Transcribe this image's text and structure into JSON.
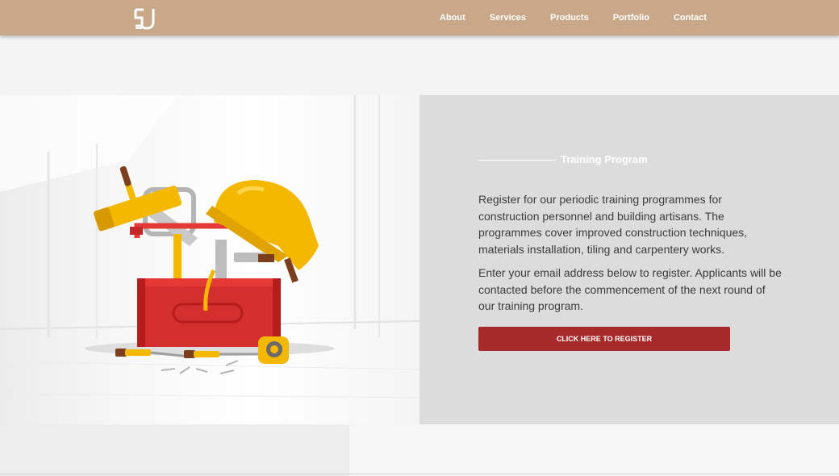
{
  "nav": {
    "logo_icon": "sj-monogram-logo",
    "links": [
      {
        "label": "About"
      },
      {
        "label": "Services"
      },
      {
        "label": "Products"
      },
      {
        "label": "Portfolio"
      },
      {
        "label": "Contact"
      }
    ]
  },
  "training": {
    "heading": "Training Program",
    "paragraph1": "Register for our periodic training programmes for construction personnel and building artisans. The programmes cover improved construction techniques, materials installation, tiling and carpentery works.",
    "paragraph2": "Enter your email address below to register. Applicants will be contacted before the commencement of the next round of our training program.",
    "register_button": "CLICK HERE TO REGISTER"
  },
  "illustration": {
    "icon": "toolbox-with-hardhat-and-tools"
  },
  "colors": {
    "navbar": "#c8a888",
    "accent_button": "#a62a2a",
    "panel_gray": "#dcdcdc",
    "toolbox_red": "#d63031",
    "hardhat_yellow": "#f7b500"
  }
}
